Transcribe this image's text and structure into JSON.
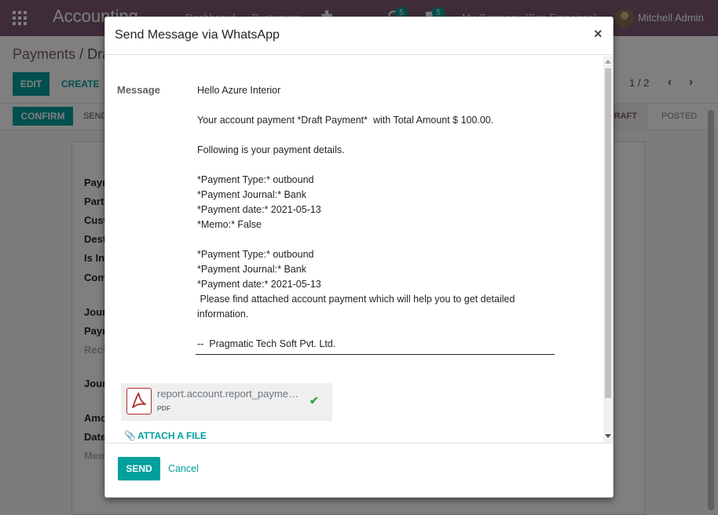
{
  "navbar": {
    "app_name": "Accounting",
    "menu_dashboard": "Dashboard",
    "menu_customers": "Customers",
    "plus": "✚",
    "activity_count": "5",
    "messages_count": "5",
    "company": "My Company (San Francisco)",
    "user": "Mitchell Admin"
  },
  "control_panel": {
    "breadcrumb_root": "Payments",
    "breadcrumb_sep": "/",
    "breadcrumb_current": "Draft Payment",
    "edit_label": "EDIT",
    "create_label": "CREATE",
    "pager": "1 / 2"
  },
  "statusbar": {
    "confirm_label": "CONFIRM",
    "send_whatsapp_label": "SEND BY WHATSAPP",
    "state_draft": "DRAFT",
    "state_posted": "POSTED"
  },
  "form_labels": [
    "Payment Type",
    "Partner Type",
    "Customer",
    "Destination Account",
    "Is Internal Transfer",
    "Company",
    "Journal",
    "Payment Method",
    "Recipient Bank Account",
    "Journal Entry",
    "Amount",
    "Date",
    "Memo"
  ],
  "modal": {
    "title": "Send Message via WhatsApp",
    "close": "×",
    "message_label": "Message",
    "message_text": "Hello Azure Interior\n\nYour account payment *Draft Payment*  with Total Amount $ 100.00.\n\nFollowing is your payment details.\n\n*Payment Type:* outbound\n*Payment Journal:* Bank\n*Payment date:* 2021-05-13\n*Memo:* False\n\n*Payment Type:* outbound\n*Payment Journal:* Bank\n*Payment date:* 2021-05-13\n Please find attached account payment which will help you to get detailed information.\n\n--  Pragmatic Tech Soft Pvt. Ltd.",
    "attachment": {
      "name": "report.account.report_payment_receipt.pdf",
      "ext": "PDF"
    },
    "attach_file_label": "ATTACH A FILE",
    "send_label": "SEND",
    "cancel_label": "Cancel"
  },
  "colors": {
    "navbar": "#7c5b73",
    "primary": "#00a09d",
    "pdf_red": "#b03030",
    "check_green": "#28a745"
  }
}
